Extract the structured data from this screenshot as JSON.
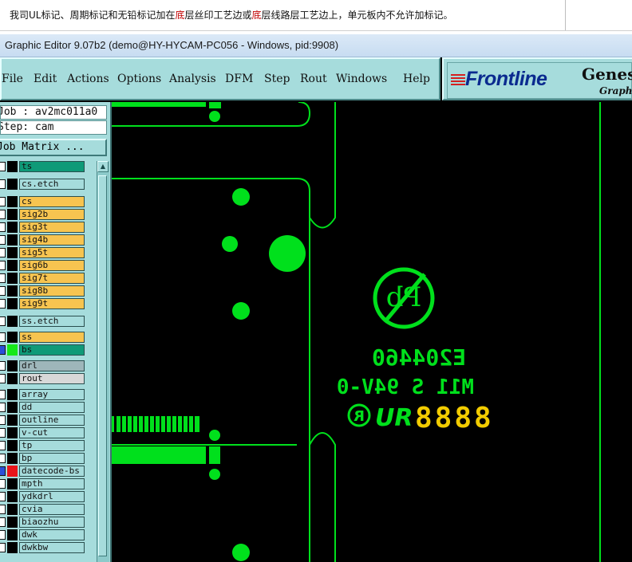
{
  "note": {
    "prefix": "我司UL标记、周期标记和无铅标记加在",
    "hl1": "底",
    "mid": "层丝印工艺边或",
    "hl2": "底",
    "suffix": "层线路层工艺边上，单元板内不允许加标记。"
  },
  "window": {
    "title": "Graphic Editor 9.07b2 (demo@HY-HYCAM-PC056 - Windows, pid:9908)"
  },
  "menu": {
    "file": "File",
    "edit": "Edit",
    "actions": "Actions",
    "options": "Options",
    "analysis": "Analysis",
    "dfm": "DFM",
    "step": "Step",
    "rout": "Rout",
    "windows": "Windows",
    "help": "Help"
  },
  "logo": {
    "name": "Frontline",
    "product": "Genesis",
    "sub": "Graphic"
  },
  "job": {
    "job_line": "Job : av2mc011a0",
    "step_line": "Step: cam",
    "matrix_button": "Job Matrix ..."
  },
  "colors": {
    "panel": "#a6dcdc",
    "canvas": "#000000",
    "copper": "#00e01c",
    "datecode": "#f2cc00",
    "highlight_text": "#c00000"
  },
  "layers": [
    {
      "name": "ts",
      "color": "#0f9a78",
      "checked": false,
      "swatch": "#000000"
    },
    {
      "name": "cs.etch",
      "color": "#a6dcdc",
      "checked": false,
      "swatch": "#000000"
    },
    {
      "name": "cs",
      "color": "#f7c450",
      "checked": false,
      "swatch": "#000000"
    },
    {
      "name": "sig2b",
      "color": "#f7c450",
      "checked": false,
      "swatch": "#000000"
    },
    {
      "name": "sig3t",
      "color": "#f7c450",
      "checked": false,
      "swatch": "#000000"
    },
    {
      "name": "sig4b",
      "color": "#f7c450",
      "checked": false,
      "swatch": "#000000"
    },
    {
      "name": "sig5t",
      "color": "#f7c450",
      "checked": false,
      "swatch": "#000000"
    },
    {
      "name": "sig6b",
      "color": "#f7c450",
      "checked": false,
      "swatch": "#000000"
    },
    {
      "name": "sig7t",
      "color": "#f7c450",
      "checked": false,
      "swatch": "#000000"
    },
    {
      "name": "sig8b",
      "color": "#f7c450",
      "checked": false,
      "swatch": "#000000"
    },
    {
      "name": "sig9t",
      "color": "#f7c450",
      "checked": false,
      "swatch": "#000000"
    },
    {
      "name": "ss.etch",
      "color": "#a6dcdc",
      "checked": false,
      "swatch": "#000000"
    },
    {
      "name": "ss",
      "color": "#f7c450",
      "checked": false,
      "swatch": "#000000"
    },
    {
      "name": "bs",
      "color": "#0f9a78",
      "checked": true,
      "swatch": "#16e81a"
    },
    {
      "name": "drl",
      "color": "#9eb6ba",
      "checked": false,
      "swatch": "#000000"
    },
    {
      "name": "rout",
      "color": "#d8d8d8",
      "checked": false,
      "swatch": "#000000"
    },
    {
      "name": "array",
      "color": "#a6dcdc",
      "checked": false,
      "swatch": "#000000"
    },
    {
      "name": "dd",
      "color": "#a6dcdc",
      "checked": false,
      "swatch": "#000000"
    },
    {
      "name": "outline",
      "color": "#a6dcdc",
      "checked": false,
      "swatch": "#000000"
    },
    {
      "name": "v-cut",
      "color": "#a6dcdc",
      "checked": false,
      "swatch": "#000000"
    },
    {
      "name": "tp",
      "color": "#a6dcdc",
      "checked": false,
      "swatch": "#000000"
    },
    {
      "name": "bp",
      "color": "#a6dcdc",
      "checked": false,
      "swatch": "#000000"
    },
    {
      "name": "datecode-bs",
      "color": "#a6dcdc",
      "checked": true,
      "swatch": "#e8141a"
    },
    {
      "name": "mpth",
      "color": "#a6dcdc",
      "checked": false,
      "swatch": "#000000"
    },
    {
      "name": "ydkdrl",
      "color": "#a6dcdc",
      "checked": false,
      "swatch": "#000000"
    },
    {
      "name": "cvia",
      "color": "#a6dcdc",
      "checked": false,
      "swatch": "#000000"
    },
    {
      "name": "biaozhu",
      "color": "#a6dcdc",
      "checked": false,
      "swatch": "#000000"
    },
    {
      "name": "dwk",
      "color": "#a6dcdc",
      "checked": false,
      "swatch": "#000000"
    },
    {
      "name": "dwkbw",
      "color": "#a6dcdc",
      "checked": false,
      "swatch": "#000000"
    }
  ],
  "canvas": {
    "pb_letters": "Pb",
    "ul_number": "E204460",
    "material": "M11 S 94V-0",
    "ur_mark": "R",
    "ur_letters": "UR",
    "datecode": "8888"
  }
}
